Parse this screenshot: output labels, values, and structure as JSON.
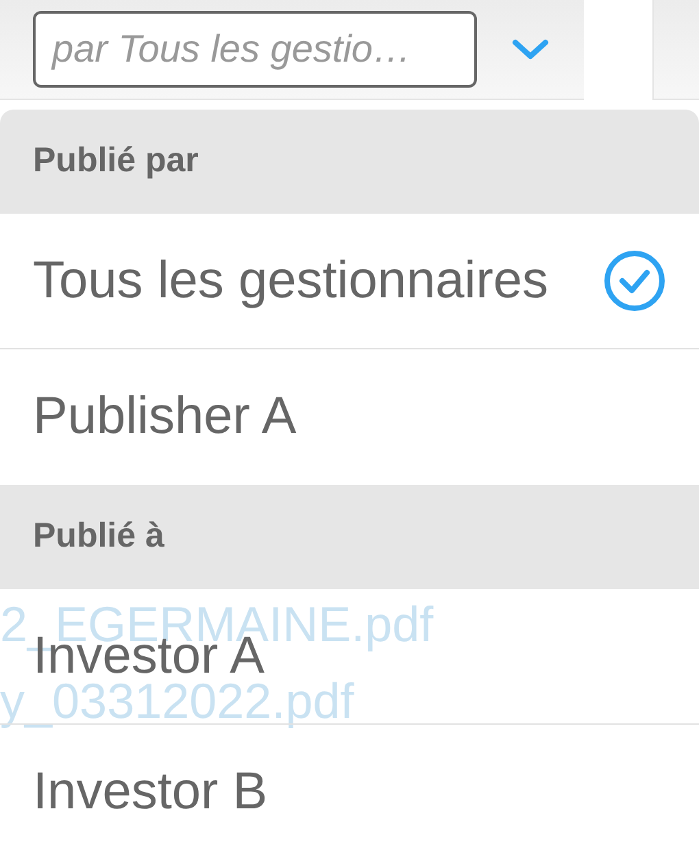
{
  "filter": {
    "placeholder": "par Tous les gestio…",
    "expanded": true
  },
  "menu": {
    "sections": [
      {
        "heading": "Publié par",
        "items": [
          {
            "label": "Tous les gestionnaires",
            "selected": true
          },
          {
            "label": "Publisher A",
            "selected": false
          }
        ]
      },
      {
        "heading": "Publié à",
        "items": [
          {
            "label": "Investor A",
            "selected": false
          },
          {
            "label": "Investor B",
            "selected": false
          }
        ]
      }
    ]
  },
  "background_texts": [
    "2_EGERMAINE.pdf",
    "y_03312022.pdf"
  ]
}
